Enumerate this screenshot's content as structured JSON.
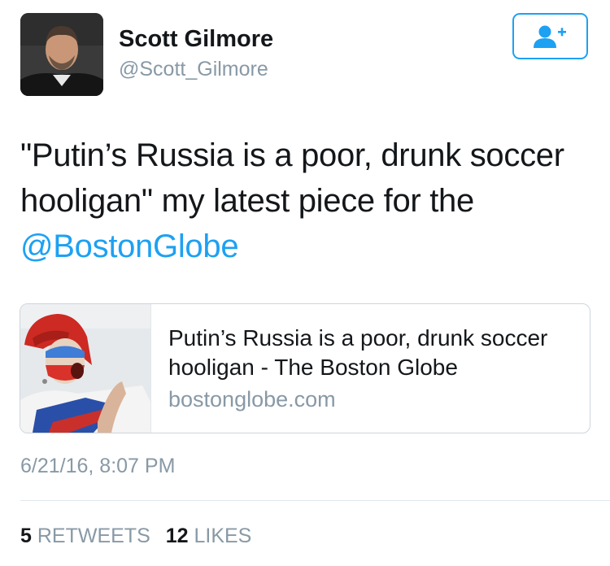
{
  "user": {
    "display_name": "Scott Gilmore",
    "handle": "@Scott_Gilmore"
  },
  "follow_button": {
    "icon": "follow-user-plus-icon"
  },
  "tweet": {
    "line1": "\"Putin’s Russia is a poor, drunk soccer",
    "line2": "hooligan\" my latest piece for the",
    "mention": "@BostonGlobe"
  },
  "card": {
    "title": "Putin’s Russia is a poor, drunk soccer hooligan - The Boston Globe",
    "domain": "bostonglobe.com"
  },
  "timestamp": "6/21/16, 8:07 PM",
  "stats": {
    "retweets_count": "5",
    "retweets_label": "RETWEETS",
    "likes_count": "12",
    "likes_label": "LIKES"
  },
  "colors": {
    "accent": "#1da1f2",
    "muted_text": "#8899a6",
    "border": "#ccd6dd"
  }
}
